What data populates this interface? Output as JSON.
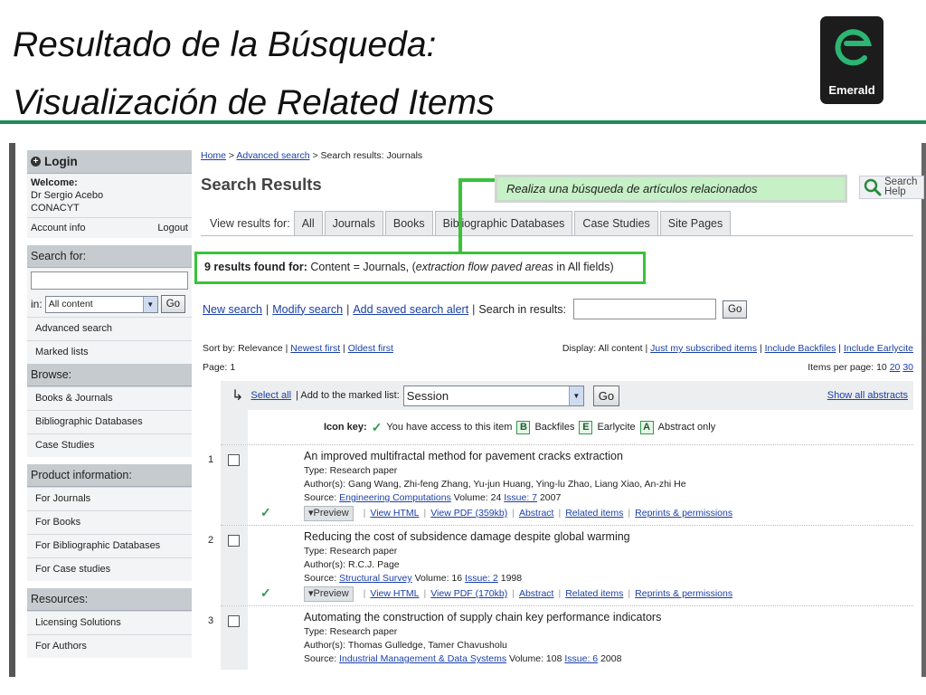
{
  "slide": {
    "title_line1": "Resultado de la Búsqueda:",
    "title_line2": "Visualización de Related Items",
    "logo_text": "Emerald",
    "callout": "Realiza una búsqueda de artículos relacionados"
  },
  "colors": {
    "accent_green": "#39c23a",
    "rule_green": "#1f8a57",
    "link": "#1a3fa8",
    "sidebar_head": "#c6cbcf"
  },
  "sidebar": {
    "login": "Login",
    "welcome_label": "Welcome:",
    "user_name": "Dr Sergio Acebo",
    "user_org": "CONACYT",
    "account_info": "Account info",
    "logout": "Logout",
    "search_for": "Search for:",
    "in_label": "in:",
    "in_value": "All content",
    "go": "Go",
    "advanced_search": "Advanced search",
    "marked_lists": "Marked lists",
    "browse": "Browse:",
    "browse_items": [
      "Books & Journals",
      "Bibliographic Databases",
      "Case Studies"
    ],
    "product_info": "Product information:",
    "product_items": [
      "For Journals",
      "For Books",
      "For Bibliographic Databases",
      "For Case studies"
    ],
    "resources": "Resources:",
    "resource_items": [
      "Licensing Solutions",
      "For Authors"
    ]
  },
  "main": {
    "breadcrumb": {
      "home": "Home",
      "sep1": " > ",
      "advanced": "Advanced search",
      "sep2": " > ",
      "current": "Search results: Journals"
    },
    "title": "Search Results",
    "help": "Search Help",
    "view_results_for": "View results for:",
    "tabs": [
      "All",
      "Journals",
      "Books",
      "Bibliographic Databases",
      "Case Studies",
      "Site Pages"
    ],
    "found_prefix": "9 results found for:",
    "found_content": " Content = Journals, (",
    "found_query": "extraction flow paved areas",
    "found_suffix": " in All fields)",
    "new_search": "New search",
    "modify_search": "Modify search",
    "add_alert": "Add saved search alert",
    "search_in_results": "Search in results:",
    "go": "Go",
    "sort_by": "Sort by: Relevance |",
    "newest": "Newest first",
    "oldest": "Oldest first",
    "display": "Display: All content |",
    "just_subscribed": "Just my subscribed items",
    "include_backfiles": "Include Backfiles",
    "include_earlycite": "Include Earlycite",
    "page": "Page: 1",
    "items_per_page": "Items per page: 10",
    "per_20": "20",
    "per_30": "30",
    "select_all": "Select all",
    "add_marked": "| Add to the marked list:",
    "marked_list_value": "Session",
    "show_all_abstracts": "Show all abstracts",
    "icon_key_label": "Icon key:",
    "key_access": "You have access to this item",
    "key_backfiles": "Backfiles",
    "key_earlycite": "Earlycite",
    "key_abstract": "Abstract only",
    "badge_b": "B",
    "badge_e": "E",
    "badge_a": "A"
  },
  "results": [
    {
      "num": "1",
      "title": "An improved multifractal method for pavement cracks extraction",
      "type": "Type: Research paper",
      "authors": "Author(s): Gang Wang, Zhi-feng Zhang, Yu-jun Huang, Ying-lu Zhao, Liang Xiao, An-zhi He",
      "source_label": "Source:",
      "source": "Engineering Computations",
      "volume": "Volume: 24",
      "issue": "Issue: 7",
      "year": "2007",
      "preview": "▾Preview",
      "html": "View HTML",
      "pdf": "View PDF (359kb)",
      "abstract": "Abstract",
      "related": "Related items",
      "reprints": "Reprints & permissions"
    },
    {
      "num": "2",
      "title": "Reducing the cost of subsidence damage despite global warming",
      "type": "Type: Research paper",
      "authors": "Author(s): R.C.J. Page",
      "source_label": "Source:",
      "source": "Structural Survey",
      "volume": "Volume: 16",
      "issue": "Issue: 2",
      "year": "1998",
      "preview": "▾Preview",
      "html": "View HTML",
      "pdf": "View PDF (170kb)",
      "abstract": "Abstract",
      "related": "Related items",
      "reprints": "Reprints & permissions"
    },
    {
      "num": "3",
      "title": "Automating the construction of supply chain key performance indicators",
      "type": "Type: Research paper",
      "authors": "Author(s): Thomas Gulledge, Tamer Chavusholu",
      "source_label": "Source:",
      "source": "Industrial Management & Data Systems",
      "volume": "Volume: 108",
      "issue": "Issue: 6",
      "year": "2008"
    }
  ]
}
